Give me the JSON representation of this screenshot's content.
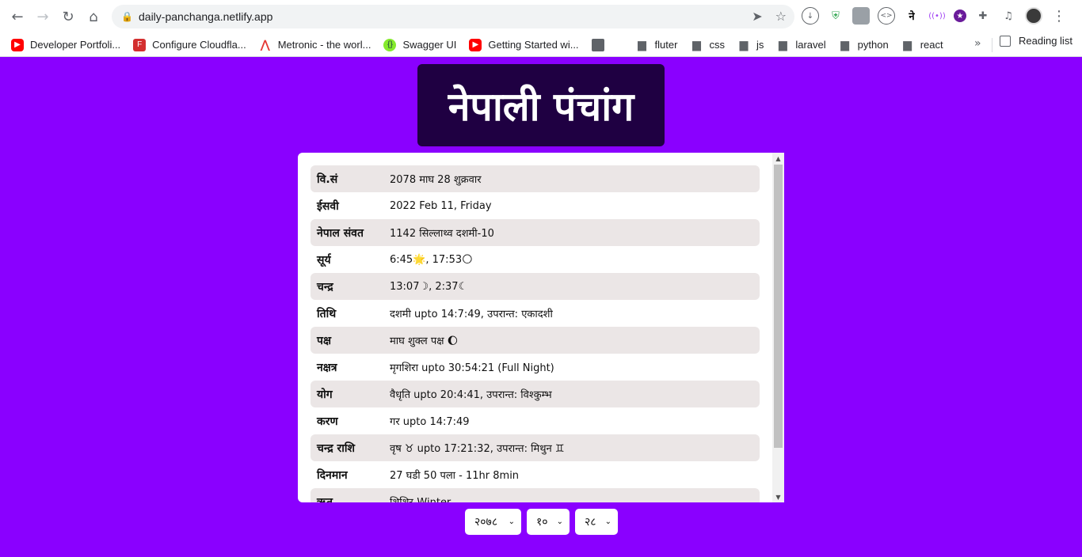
{
  "browser": {
    "url": "daily-panchanga.netlify.app",
    "bookmarks": [
      {
        "label": "Developer Portfoli...",
        "icon": "youtube-icon"
      },
      {
        "label": "Configure Cloudfla...",
        "icon": "cloudflare-icon"
      },
      {
        "label": "Metronic - the worl...",
        "icon": "metronic-icon"
      },
      {
        "label": "Swagger UI",
        "icon": "swagger-icon"
      },
      {
        "label": "Getting Started wi...",
        "icon": "youtube-icon"
      },
      {
        "label": "",
        "icon": "grid-icon"
      },
      {
        "label": "fluter",
        "icon": "folder-icon"
      },
      {
        "label": "css",
        "icon": "folder-icon"
      },
      {
        "label": "js",
        "icon": "folder-icon"
      },
      {
        "label": "laravel",
        "icon": "folder-icon"
      },
      {
        "label": "python",
        "icon": "folder-icon"
      },
      {
        "label": "react",
        "icon": "folder-icon"
      }
    ],
    "more_label": "»",
    "reading_list": "Reading list"
  },
  "page": {
    "title": "नेपाली पंचांग",
    "rows": [
      {
        "label": "वि.सं",
        "value": "2078 माघ 28 शुक्रवार"
      },
      {
        "label": "ईसवी",
        "value": "2022 Feb 11, Friday"
      },
      {
        "label": "नेपाल संवत",
        "value": "1142 सिल्लाथ्व दशमी-10"
      },
      {
        "label": "सूर्य",
        "value": "6:45🌟, 17:53🌕"
      },
      {
        "label": "चन्द्र",
        "value": "13:07☽, 2:37☾"
      },
      {
        "label": "तिथि",
        "value": "दशमी upto 14:7:49, उपरान्त: एकादशी"
      },
      {
        "label": "पक्ष",
        "value": "माघ शुक्ल पक्ष 🌔"
      },
      {
        "label": "नक्षत्र",
        "value": "मृगशिरा upto 30:54:21 (Full Night)"
      },
      {
        "label": "योग",
        "value": "वैधृति upto 20:4:41, उपरान्त: विश्कुम्भ"
      },
      {
        "label": "करण",
        "value": "गर upto 14:7:49"
      },
      {
        "label": "चन्द्र राशि",
        "value": "वृष ♉ upto 17:21:32, उपरान्त: मिथुन ♊"
      },
      {
        "label": "दिनमान",
        "value": "27 घडी 50 पला - 11hr 8min"
      },
      {
        "label": "ऋतु",
        "value": "शिशिर-Winter"
      }
    ],
    "selects": {
      "year": "२०७८",
      "month": "१०",
      "day": "२८"
    }
  }
}
